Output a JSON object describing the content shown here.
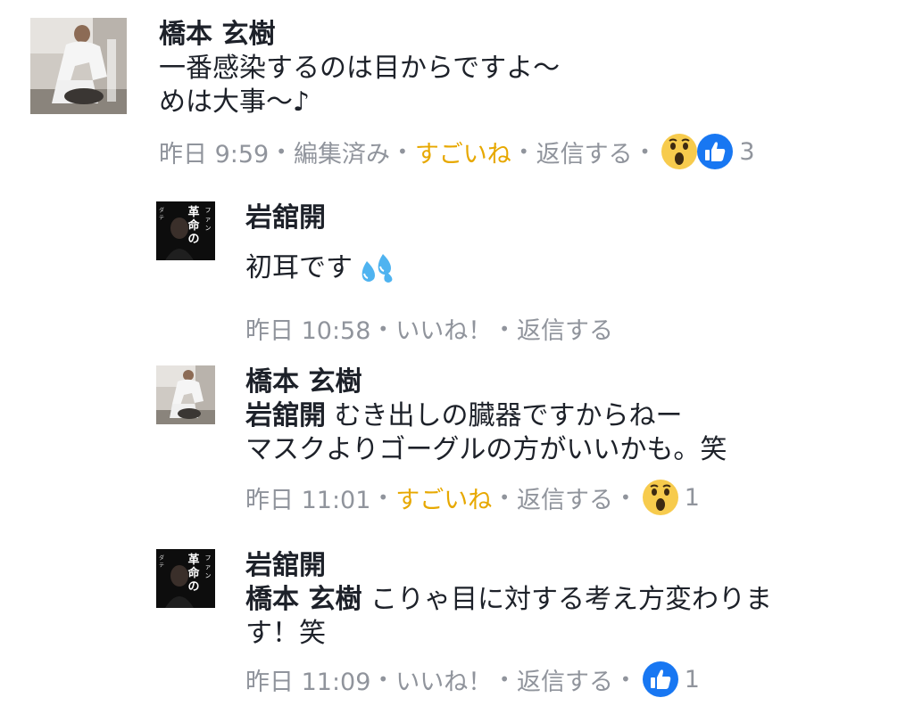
{
  "comments": [
    {
      "author": "橋本 玄樹",
      "lines": [
        "一番感染するのは目からですよ〜",
        "めは大事〜♪"
      ],
      "meta": {
        "time": "昨日 9:59",
        "edited": "編集済み",
        "like": "すごいね",
        "reply": "返信する",
        "reaction_count": "3"
      }
    },
    {
      "author": "岩舘開",
      "text": "初耳です",
      "meta": {
        "time": "昨日 10:58",
        "like": "いいね！",
        "reply": "返信する"
      }
    },
    {
      "author": "橋本 玄樹",
      "mention": "岩舘開",
      "line1": " むき出しの臓器ですからねー",
      "line2": "マスクよりゴーグルの方がいいかも。笑",
      "meta": {
        "time": "昨日 11:01",
        "like": "すごいね",
        "reply": "返信する",
        "reaction_count": "1"
      }
    },
    {
      "author": "岩舘開",
      "mention": "橋本 玄樹",
      "line1": " こりゃ目に対する考え方変わりま",
      "line2": "す！笑",
      "meta": {
        "time": "昨日 11:09",
        "like": "いいね！",
        "reply": "返信する",
        "reaction_count": "1"
      }
    }
  ],
  "avatar_books": {
    "title_chars": "革命のファンファーレ",
    "side_text": "ダテカイ"
  },
  "colors": {
    "text": "#1d2129",
    "meta": "#90949c",
    "active_reaction": "#e7a800",
    "like_blue": "#1877f2",
    "wow_yellow": "#f7cb4d"
  },
  "icons": {
    "like": "thumbs-up-icon",
    "wow": "wow-face-icon",
    "sweat": "sweat-droplets-icon"
  }
}
